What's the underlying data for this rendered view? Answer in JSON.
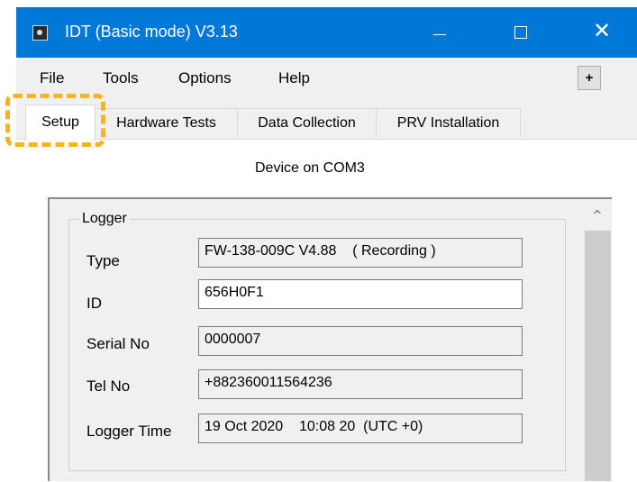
{
  "window": {
    "title": "IDT (Basic mode) V3.13",
    "icon": "app-icon",
    "controls": {
      "minimize_icon": "minimize-icon",
      "maximize_icon": "maximize-icon",
      "close_glyph": "✕"
    }
  },
  "menu": {
    "items": [
      "File",
      "Tools",
      "Options",
      "Help"
    ],
    "plus_label": "+"
  },
  "tabs": [
    "Setup",
    "Hardware Tests",
    "Data Collection",
    "PRV Installation"
  ],
  "active_tab": "Setup",
  "device_label": "Device on COM3",
  "logger": {
    "group_label": "Logger",
    "fields": [
      {
        "label": "Type",
        "value": "FW-138-009C V4.88    ( Recording )"
      },
      {
        "label": "ID",
        "value": "656H0F1"
      },
      {
        "label": "Serial No",
        "value": "0000007"
      },
      {
        "label": "Tel No",
        "value": "+882360011564236"
      },
      {
        "label": "Logger Time",
        "value": "19 Oct 2020    10:08 20  (UTC +0)"
      }
    ]
  },
  "scrollbar": {
    "up_arrow": "^"
  },
  "colors": {
    "titlebar": "#0078d7",
    "highlight": "#f6b51b",
    "panel": "#f0f0f0"
  }
}
